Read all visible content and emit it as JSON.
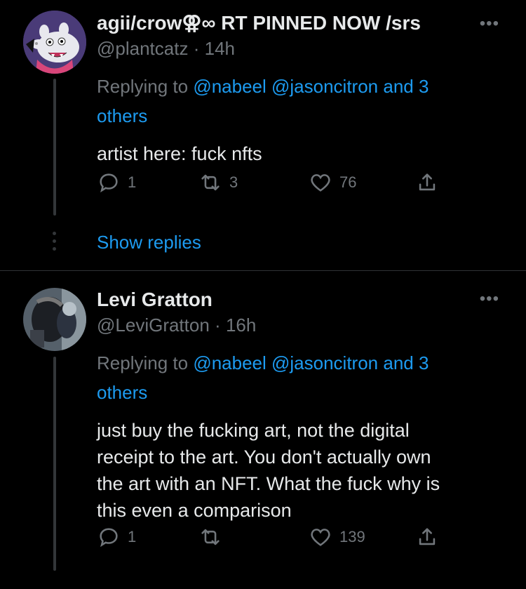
{
  "tweets": [
    {
      "display_name": "agii/crow⚢∞ RT PINNED NOW /srs",
      "handle": "@plantcatz",
      "separator": "·",
      "time": "14h",
      "replying_prefix": "Replying to",
      "replying_mentions": "@nabeel @jasoncitron",
      "replying_and": "and 3",
      "replying_others": "others",
      "text": "artist here: fuck nfts",
      "reply_count": "1",
      "retweet_count": "3",
      "like_count": "76",
      "avatar_icon": "peppa-character-avatar"
    },
    {
      "display_name": "Levi Gratton",
      "handle": "@LeviGratton",
      "separator": "·",
      "time": "16h",
      "replying_prefix": "Replying to",
      "replying_mentions": "@nabeel @jasoncitron",
      "replying_and": "and 3",
      "replying_others": "others",
      "text_lines": [
        "just buy the fucking art, not the digital",
        "receipt to the art. You don't actually own",
        "the art with an NFT. What the fuck why is",
        "this even a comparison"
      ],
      "reply_count": "1",
      "retweet_count": "",
      "like_count": "139",
      "avatar_icon": "photo-avatar"
    }
  ],
  "show_replies_label": "Show replies",
  "more_label": "•••",
  "colors": {
    "link": "#1d9bf0",
    "muted": "#71767b",
    "text": "#e7e9ea",
    "background": "#000000"
  }
}
